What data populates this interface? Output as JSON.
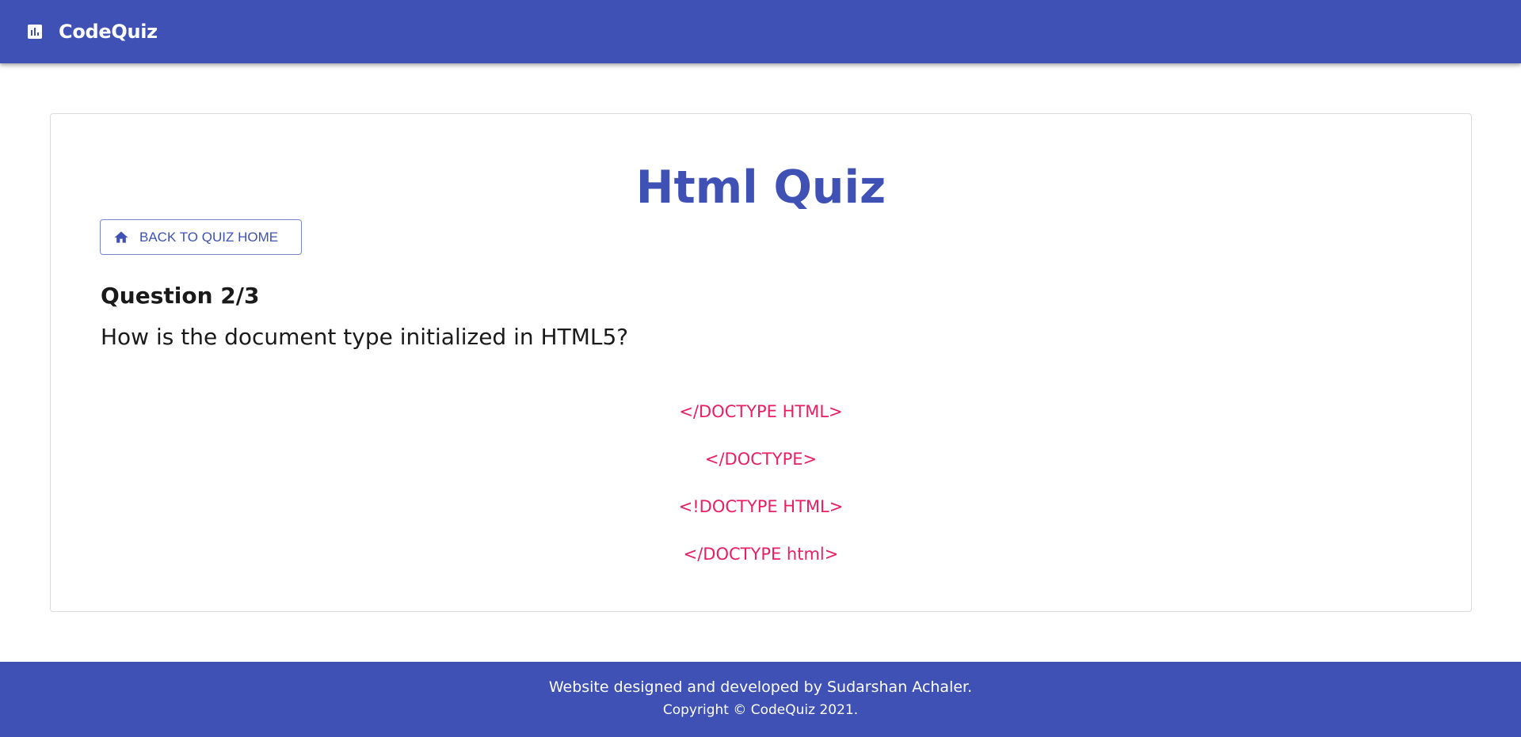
{
  "appbar": {
    "logo_icon": "bar-chart-icon",
    "brand": "CodeQuiz"
  },
  "quiz": {
    "title": "Html Quiz",
    "back_button": {
      "icon": "home-icon",
      "label": "Back to Quiz Home"
    },
    "question_number": "Question 2/3",
    "question_text": "How is the document type initialized in HTML5?",
    "options": [
      "</DOCTYPE HTML>",
      "</DOCTYPE>",
      "<!DOCTYPE HTML>",
      "</DOCTYPE html>"
    ]
  },
  "footer": {
    "credit": "Website designed and developed by Sudarshan Achaler.",
    "copyright": "Copyright © CodeQuiz 2021."
  },
  "colors": {
    "primary": "#3f51b5",
    "option_text": "#e91e63",
    "background": "#ffffff"
  }
}
